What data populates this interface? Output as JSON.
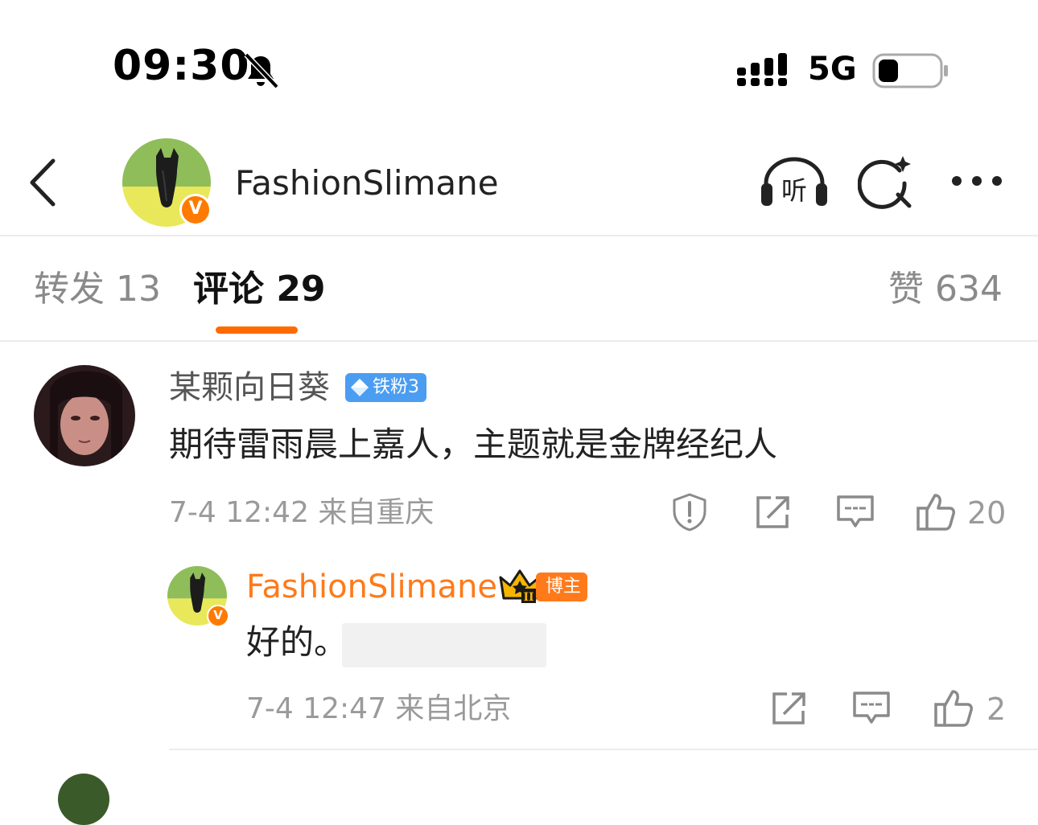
{
  "status_bar": {
    "time": "09:30",
    "network": "5G",
    "muted": true,
    "battery_level": 0.2
  },
  "header": {
    "title": "FashionSlimane",
    "verified_badge": "V",
    "listen_label": "听",
    "icons": [
      "chevron-left-icon",
      "listen-icon",
      "search-sparkle-icon",
      "more-icon"
    ]
  },
  "tabs": {
    "repost": "转发 13",
    "comment": "评论 29",
    "like": "赞 634",
    "active": "comment",
    "accent_color": "#ff6a00"
  },
  "comments": [
    {
      "username": "某颗向日葵",
      "fan_badge": "铁粉3",
      "text": "期待雷雨晨上嘉人，主题就是金牌经纪人",
      "meta": "7-4 12:42 来自重庆",
      "like_count": "20",
      "actions": [
        "report-icon",
        "share-icon",
        "reply-icon",
        "like-icon"
      ]
    }
  ],
  "replies": [
    {
      "username": "FashionSlimane",
      "host_badge": "博主",
      "crown_level": "II",
      "verified_badge": "V",
      "text": "好的。",
      "meta": "7-4 12:47 来自北京",
      "like_count": "2",
      "actions": [
        "share-icon",
        "reply-icon",
        "like-icon"
      ]
    }
  ],
  "colors": {
    "brand_orange": "#ff7a1a",
    "fan_badge_blue": "#4b9df2",
    "muted_text": "#9a9a9a"
  }
}
